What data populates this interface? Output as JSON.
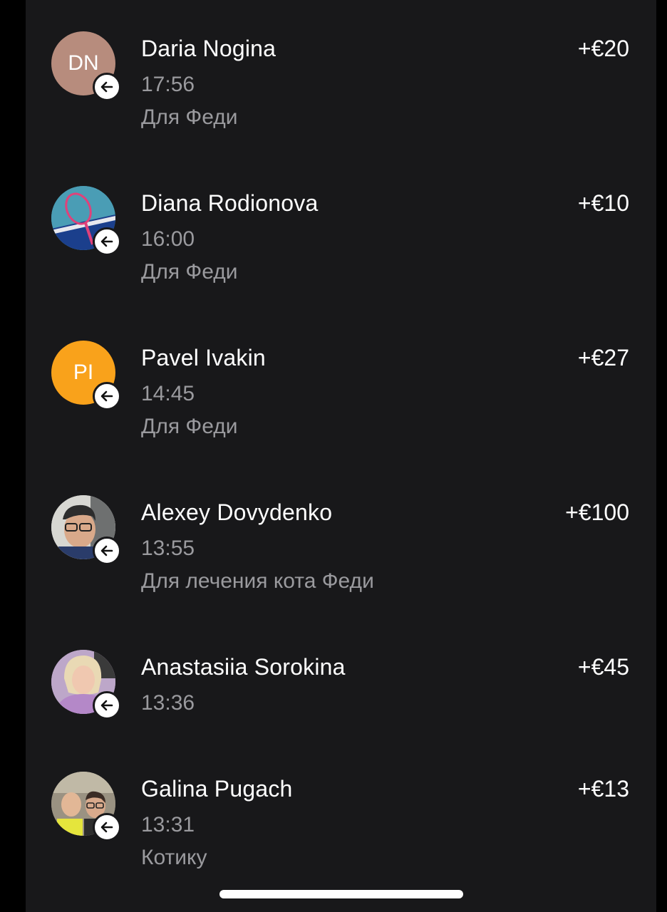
{
  "transactions": [
    {
      "name": "Daria Nogina",
      "initials": "DN",
      "avatar_color": "#b78c7d",
      "avatar_type": "initials",
      "time": "17:56",
      "note": "Для Феди",
      "amount": "+€20",
      "direction_icon": "arrow-left-icon"
    },
    {
      "name": "Diana Rodionova",
      "initials": "",
      "avatar_type": "photo",
      "time": "16:00",
      "note": "Для Феди",
      "amount": "+€10",
      "direction_icon": "arrow-left-icon"
    },
    {
      "name": "Pavel Ivakin",
      "initials": "PI",
      "avatar_color": "#f9a21b",
      "avatar_type": "initials",
      "time": "14:45",
      "note": "Для Феди",
      "amount": "+€27",
      "direction_icon": "arrow-left-icon"
    },
    {
      "name": "Alexey Dovydenko",
      "initials": "",
      "avatar_type": "photo",
      "time": "13:55",
      "note": "Для лечения кота Феди",
      "amount": "+€100",
      "direction_icon": "arrow-left-icon"
    },
    {
      "name": "Anastasiia Sorokina",
      "initials": "",
      "avatar_type": "photo",
      "time": "13:36",
      "note": "",
      "amount": "+€45",
      "direction_icon": "arrow-left-icon"
    },
    {
      "name": "Galina Pugach",
      "initials": "",
      "avatar_type": "photo",
      "time": "13:31",
      "note": "Котику",
      "amount": "+€13",
      "direction_icon": "arrow-left-icon"
    }
  ],
  "colors": {
    "background": "#18181a",
    "primary_text": "#ffffff",
    "secondary_text": "#9a9a9e"
  }
}
